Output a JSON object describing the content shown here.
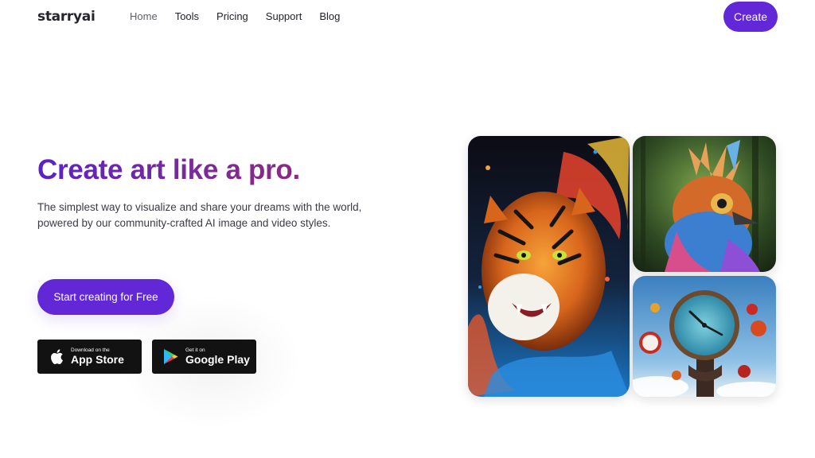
{
  "nav": {
    "logo": "starryai",
    "links": [
      "Home",
      "Tools",
      "Pricing",
      "Support",
      "Blog"
    ],
    "create_label": "Create"
  },
  "hero": {
    "headline": "Create art like a pro.",
    "subtitle": "The simplest way to visualize and share your dreams with the world, powered by our community-crafted AI image and video styles.",
    "cta_label": "Start creating for Free"
  },
  "stores": {
    "apple": {
      "small": "Download on the",
      "big": "App Store",
      "icon": "apple-icon"
    },
    "google": {
      "small": "Get it on",
      "big": "Google Play",
      "icon": "google-play-icon"
    }
  },
  "gallery": {
    "images": [
      "tiger-artwork",
      "bird-artwork",
      "clock-artwork"
    ]
  },
  "colors": {
    "accent": "#6227d6",
    "headline_gradient_start": "#5b22c9",
    "headline_gradient_end": "#8a2a82",
    "store_badge": "#121212"
  }
}
